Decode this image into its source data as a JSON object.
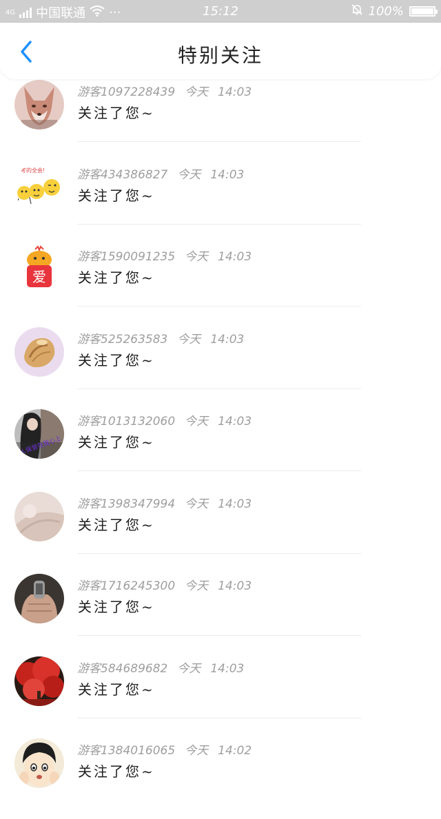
{
  "status_bar": {
    "network": "4G",
    "carrier": "中国联通",
    "more": "···",
    "time": "15:12",
    "battery": "100%",
    "battery_level": 1.0
  },
  "header": {
    "title": "特别关注",
    "back_icon": "chevron-left-icon",
    "accent_color": "#1e90ff"
  },
  "notifications": [
    {
      "user": "游客1097228439",
      "day": "今天",
      "time": "14:03",
      "message": "关注了您~",
      "avatar": "fox"
    },
    {
      "user": "游客434386827",
      "day": "今天",
      "time": "14:03",
      "message": "关注了您~",
      "avatar": "emoji-group"
    },
    {
      "user": "游客1590091235",
      "day": "今天",
      "time": "14:03",
      "message": "关注了您~",
      "avatar": "love-mascot"
    },
    {
      "user": "游客525263583",
      "day": "今天",
      "time": "14:03",
      "message": "关注了您~",
      "avatar": "shell"
    },
    {
      "user": "游客1013132060",
      "day": "今天",
      "time": "14:03",
      "message": "关注了您~",
      "avatar": "girl-photo"
    },
    {
      "user": "游客1398347994",
      "day": "今天",
      "time": "14:03",
      "message": "关注了您~",
      "avatar": "soft-pink"
    },
    {
      "user": "游客1716245300",
      "day": "今天",
      "time": "14:03",
      "message": "关注了您~",
      "avatar": "hand-ring"
    },
    {
      "user": "游客584689682",
      "day": "今天",
      "time": "14:03",
      "message": "关注了您~",
      "avatar": "red-tree"
    },
    {
      "user": "游客1384016065",
      "day": "今天",
      "time": "14:02",
      "message": "关注了您~",
      "avatar": "anime-boy"
    }
  ],
  "avatar_sign_text": "爱",
  "avatar_sticker_text": "考的全会!",
  "avatar_photo_caption": "人保曾在我心上"
}
